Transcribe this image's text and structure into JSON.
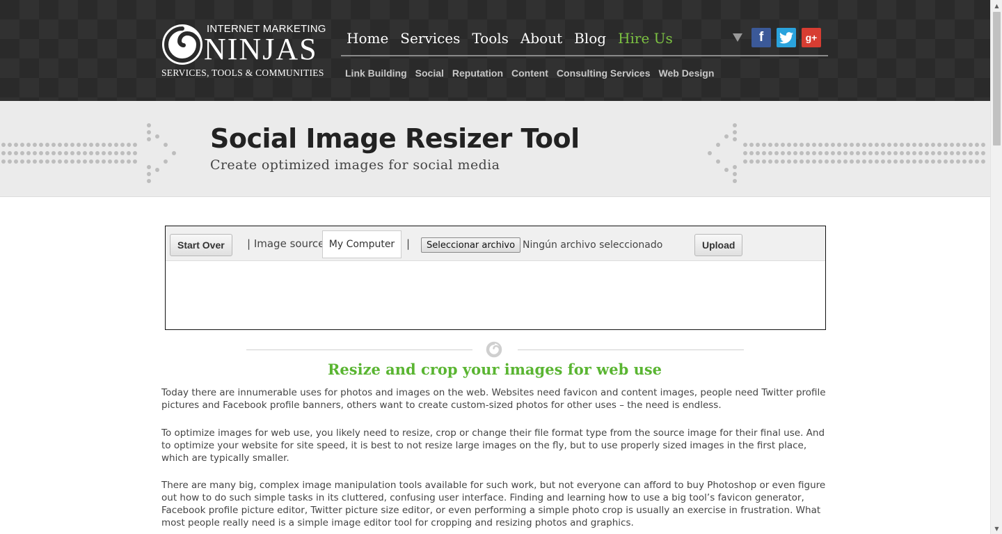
{
  "logo": {
    "line1": "INTERNET MARKETING",
    "line2": "NINJAS",
    "line3": "SERVICES, TOOLS & COMMUNITIES",
    "icon": "spiral-logo-icon"
  },
  "main_nav": {
    "home": "Home",
    "services": "Services",
    "tools": "Tools",
    "about": "About",
    "blog": "Blog",
    "hire": "Hire Us"
  },
  "sub_nav": {
    "link_building": "Link Building",
    "social": "Social",
    "reputation": "Reputation",
    "content": "Content",
    "consulting": "Consulting Services",
    "web_design": "Web Design"
  },
  "social": {
    "dropdown_icon": "triangle-down-icon",
    "facebook": "f",
    "twitter_icon": "twitter-bird-icon",
    "googleplus": "g+",
    "colors": {
      "facebook": "#3b5998",
      "twitter": "#2aa3dd",
      "googleplus": "#d73d32"
    }
  },
  "banner": {
    "title": "Social Image Resizer Tool",
    "subtitle": "Create optimized images for social media"
  },
  "tool": {
    "start_over": "Start Over",
    "separator": "|",
    "image_source_label": "| Image source:",
    "source_selected": "My Computer",
    "file_button": "Seleccionar archivo",
    "file_status": "Ningún archivo seleccionado",
    "upload": "Upload"
  },
  "content": {
    "heading": "Resize and crop your images for web use",
    "paragraphs": [
      "Today there are innumerable uses for photos and images on the web. Websites need favicon and content images, people need Twitter profile pictures and Facebook profile banners, others want to create custom-sized photos for other uses – the need is endless.",
      "To optimize images for web use, you likely need to resize, crop or change their file format type from the source image for their final use. And to optimize your website for site speed, it is best to not resize large images on the fly, but to use properly sized images in the first place, which are typically smaller.",
      "There are many big, complex image manipulation tools available for such work, but not everyone can afford to buy Photoshop or even figure out how to do such simple tasks in its cluttered, confusing user interface. Finding and learning how to use a big tool’s favicon generator, Facebook profile picture editor, Twitter picture size editor, or even performing a simple photo crop is usually an exercise in frustration. What most people really need is a simple image editor tool for cropping and resizing photos and graphics."
    ]
  },
  "colors": {
    "accent_green": "#5ab532",
    "hire_green": "#7cc242",
    "header_bg": "#2a2a2a"
  }
}
